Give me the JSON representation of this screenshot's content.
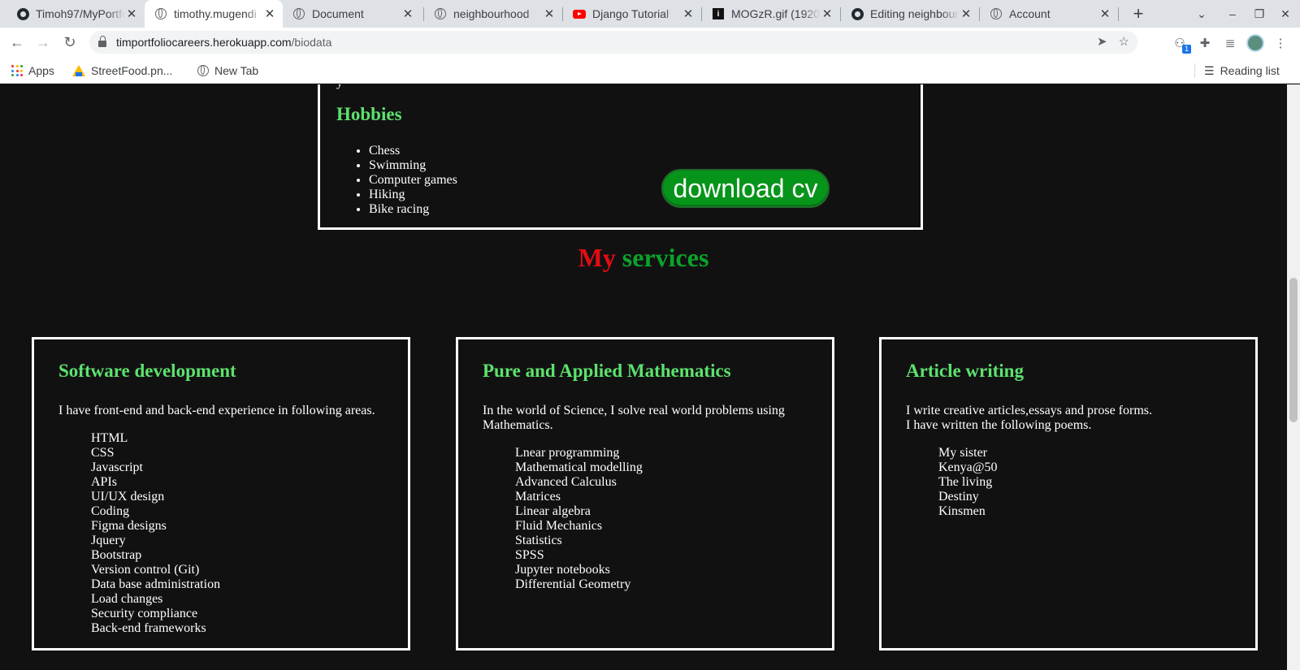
{
  "browser": {
    "tabs": [
      {
        "icon": "github-icon",
        "title": "Timoh97/MyPortfolio",
        "active": false
      },
      {
        "icon": "globe-icon",
        "title": "timothy.mugendi",
        "active": true
      },
      {
        "icon": "globe-icon",
        "title": "Document",
        "active": false
      },
      {
        "icon": "globe-icon",
        "title": "neighbourhood",
        "active": false
      },
      {
        "icon": "youtube-icon",
        "title": "Django Tutorial",
        "active": false
      },
      {
        "icon": "image-icon",
        "title": "MOGzR.gif (1920",
        "active": false
      },
      {
        "icon": "github-icon",
        "title": "Editing neighbourhood",
        "active": false
      },
      {
        "icon": "globe-icon",
        "title": "Account",
        "active": false
      }
    ],
    "url_host": "timportfoliocareers.herokuapp.com",
    "url_path": "/biodata",
    "extension_badge": "1",
    "bookmarks": [
      {
        "icon": "apps-grid-icon",
        "label": "Apps"
      },
      {
        "icon": "google-drive-icon",
        "label": "StreetFood.pn..."
      },
      {
        "icon": "globe-icon",
        "label": "New Tab"
      }
    ],
    "reading_list_label": "Reading list"
  },
  "page": {
    "cut_off_text": "y",
    "hobbies": {
      "title": "Hobbies",
      "items": [
        "Chess",
        "Swimming",
        "Computer games",
        "Hiking",
        "Bike racing"
      ]
    },
    "download_button": "download cv",
    "services_title": {
      "part1": "My",
      "part2": "services"
    },
    "services": [
      {
        "title": "Software development",
        "intro": "I have front-end and back-end experience in following areas.",
        "items": [
          "HTML",
          "CSS",
          "Javascript",
          "APIs",
          "UI/UX design",
          "Coding",
          "Figma designs",
          "Jquery",
          "Bootstrap",
          "Version control (Git)",
          "Data base administration",
          "Load changes",
          "Security compliance",
          "Back-end frameworks"
        ]
      },
      {
        "title": "Pure and Applied Mathematics",
        "intro": "In the world of Science, I solve real world problems using Mathematics.",
        "items": [
          "Lnear programming",
          "Mathematical modelling",
          "Advanced Calculus",
          "Matrices",
          "Linear algebra",
          "Fluid Mechanics",
          "Statistics",
          "SPSS",
          "Jupyter notebooks",
          "Differential Geometry"
        ]
      },
      {
        "title": "Article writing",
        "intro_lines": [
          "I write creative articles,essays and prose forms.",
          "I have written the following poems."
        ],
        "items": [
          "My sister",
          "Kenya@50",
          "The living",
          "Destiny",
          "Kinsmen"
        ]
      }
    ]
  },
  "colors": {
    "background": "#121112",
    "heading_green": "#5ce26d",
    "services_red": "#e30d12",
    "services_green": "#0ba22a",
    "button_green": "#07941a"
  }
}
